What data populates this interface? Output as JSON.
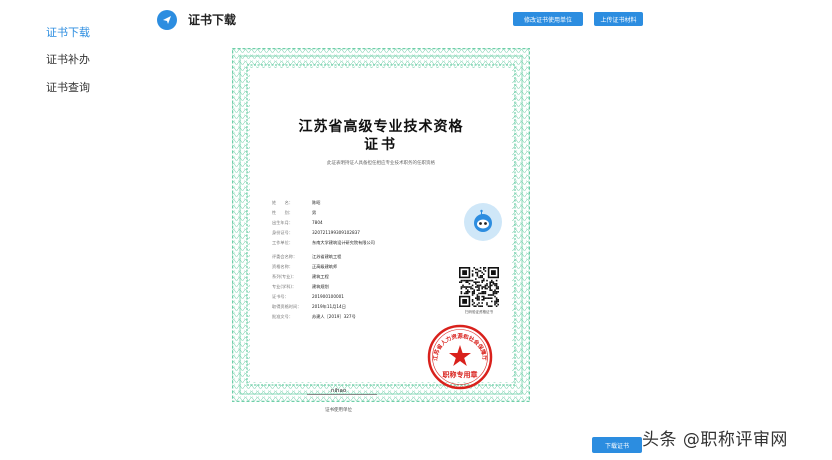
{
  "sidebar": {
    "items": [
      {
        "label": "证书下载",
        "active": true
      },
      {
        "label": "证书补办",
        "active": false
      },
      {
        "label": "证书查询",
        "active": false
      }
    ]
  },
  "header": {
    "icon": "paper-plane-icon",
    "title": "证书下载",
    "buttons": {
      "modify_unit": "修改证书使用单位",
      "upload_materials": "上传证书材料"
    }
  },
  "certificate": {
    "title_line1": "江苏省高级专业技术资格",
    "title_line2": "证书",
    "subtitle": "此证表明持证人具备担任相应专业技术职务的任职资格",
    "fields": [
      {
        "label": "姓　　名：",
        "value": "陈昭"
      },
      {
        "label": "性　　别：",
        "value": "男"
      },
      {
        "label": "出生年月：",
        "value": "7804"
      },
      {
        "label": "身份证号：",
        "value": "320721199309102837"
      },
      {
        "label": "工作单位：",
        "value": "东南大学建筑设计研究院有限公司"
      },
      {
        "label": "评委会名称：",
        "value": "江苏省建筑工程"
      },
      {
        "label": "资格名称：",
        "value": "正高级建筑师"
      },
      {
        "label": "系列(专业)：",
        "value": "建筑工程"
      },
      {
        "label": "专业(学科)：",
        "value": "建筑规划"
      },
      {
        "label": "证书号：",
        "value": "201900100001"
      },
      {
        "label": "取得资格时间：",
        "value": "2019年11月14日"
      },
      {
        "label": "批准文号：",
        "value": "苏建人［2019］327号"
      }
    ],
    "signature": "nihao",
    "qr_caption": "扫码验证资格证书",
    "stamp_text": "江苏省人力资源和社会保障厅",
    "stamp_subtext": "职称专用章",
    "unit_label": "证书使用单位"
  },
  "footer": {
    "download_button": "下载证书"
  },
  "watermark": "头条 @职称评审网",
  "colors": {
    "accent": "#2c8de0",
    "border_green": "#6fcfa9",
    "stamp_red": "#d9211c"
  }
}
